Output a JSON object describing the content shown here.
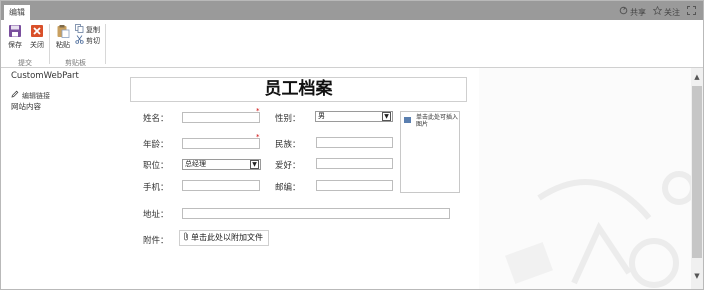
{
  "topbar": {
    "tab_label": "编辑",
    "share_label": "共享",
    "follow_label": "关注"
  },
  "ribbon": {
    "save_label": "保存",
    "close_label": "关闭",
    "paste_label": "粘贴",
    "copy_label": "复制",
    "cut_label": "剪切",
    "group_commit": "提交",
    "group_clipboard": "剪贴板"
  },
  "nav": {
    "title": "CustomWebPart",
    "edit_links": "编辑链接",
    "site_contents": "网站内容"
  },
  "form": {
    "title": "员工档案",
    "required_mark": "*",
    "labels": {
      "name": "姓名：",
      "age": "年龄：",
      "position": "职位：",
      "mobile": "手机：",
      "address": "地址：",
      "attachment": "附件：",
      "gender": "性别：",
      "ethnicity": "民族：",
      "hobby": "爱好：",
      "postcode": "邮编："
    },
    "values": {
      "name": "",
      "age": "",
      "mobile": "",
      "address": "",
      "ethnicity": "",
      "hobby": "",
      "postcode": ""
    },
    "gender_selected": "男",
    "position_selected": "总经理",
    "photo_hint": "单击此处可插入图片",
    "attach_link": "单击此处以附加文件"
  },
  "colors": {
    "topbar": "#9a9a9a",
    "required": "#cc0000",
    "save_icon": "#7a4f9e",
    "close_icon": "#d9502a"
  }
}
